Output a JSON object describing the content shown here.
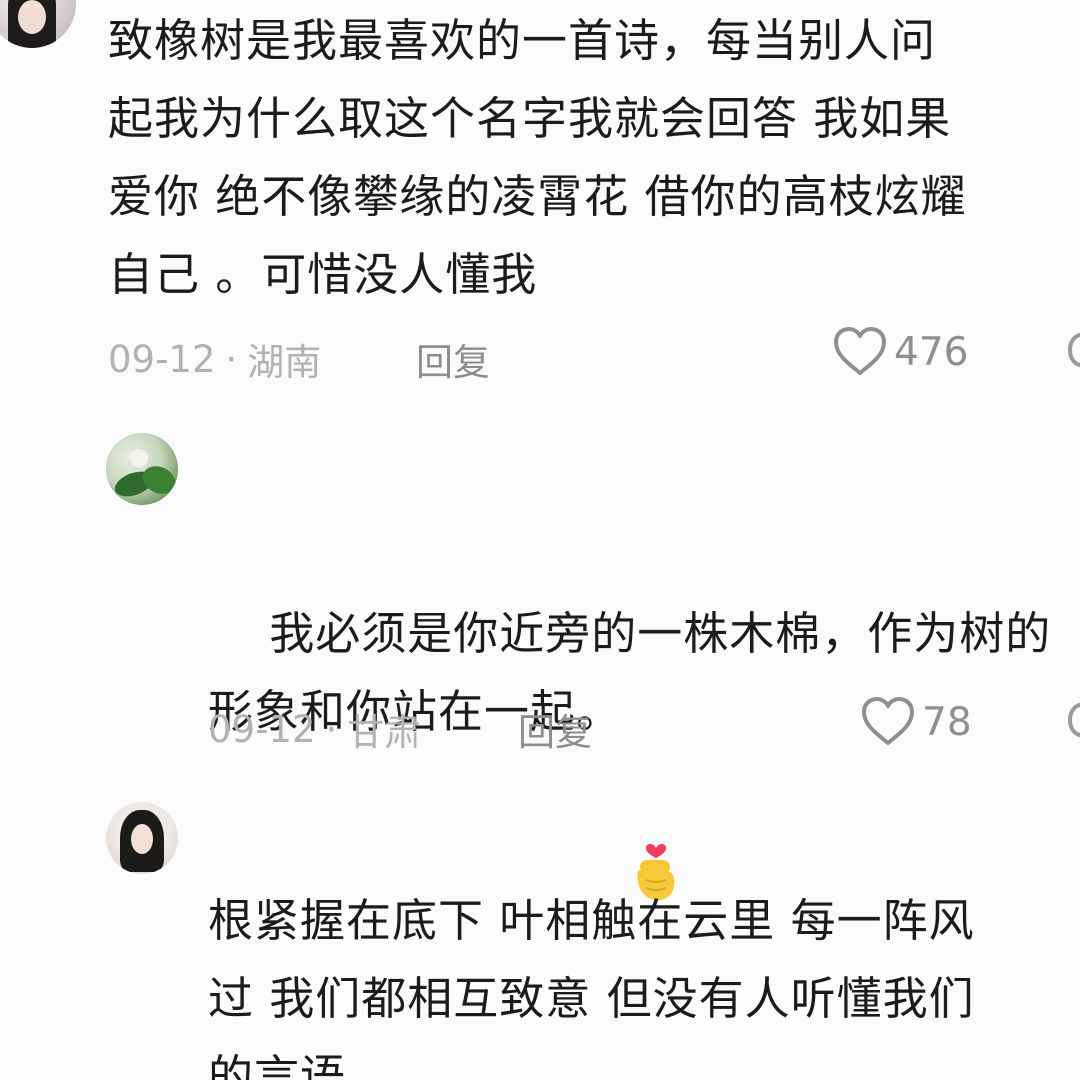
{
  "comments": [
    {
      "text": "致橡树是我最喜欢的一首诗，每当别人问\n起我为什么取这个名字我就会回答 我如果\n爱你 绝不像攀缘的凌霄花 借你的高枝炫耀\n自己 。可惜没人懂我",
      "date": "09-12",
      "location": "湖南",
      "reply_label": "回复",
      "likes": "476"
    },
    {
      "text": "我必须是你近旁的一株木棉，作为树的\n形象和你站在一起。",
      "emoji": "finger-heart-emoji",
      "date": "09-12",
      "location": "甘肃",
      "reply_label": "回复",
      "likes": "78"
    },
    {
      "text": "根紧握在底下 叶相触在云里 每一阵风\n过 我们都相互致意 但没有人听懂我们\n的言语"
    }
  ],
  "separator": "·",
  "icons": {
    "like": "heart-outline-icon",
    "edge": "comment-bubble-icon"
  },
  "colors": {
    "text": "#1b1b1b",
    "meta": "#b2b2b2",
    "reply": "#8d8d8d",
    "like": "#8f8f8f",
    "emoji_yellow": "#f7c938",
    "emoji_heart": "#ee3f5a"
  }
}
